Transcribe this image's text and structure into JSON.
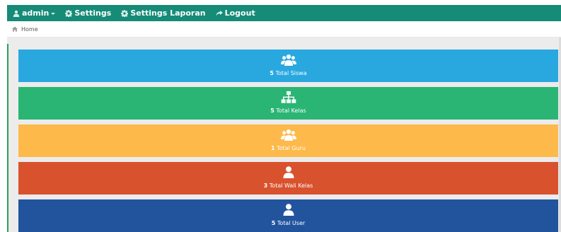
{
  "topnav": {
    "user": {
      "label": "admin",
      "icon": "user-icon"
    },
    "items": [
      {
        "label": "Settings",
        "icon": "gear-icon"
      },
      {
        "label": "Settings Laporan",
        "icon": "gear-icon"
      },
      {
        "label": "Logout",
        "icon": "share-arrow-icon"
      }
    ]
  },
  "breadcrumb": {
    "icon": "home-icon",
    "label": "Home"
  },
  "tiles": [
    {
      "count": "5",
      "label": "Total Siswa",
      "icon": "users-group-icon",
      "color": "#29a8e0"
    },
    {
      "count": "5",
      "label": "Total Kelas",
      "icon": "sitemap-icon",
      "color": "#2ab574"
    },
    {
      "count": "1",
      "label": "Total Guru",
      "icon": "users-group-icon",
      "color": "#fdb94a"
    },
    {
      "count": "3",
      "label": "Total Wali Kelas",
      "icon": "user-icon",
      "color": "#d9522e"
    },
    {
      "count": "5",
      "label": "Total User",
      "icon": "user-icon",
      "color": "#22549e"
    }
  ],
  "colors": {
    "topbar": "#168b77",
    "content_bg": "#ececec"
  }
}
